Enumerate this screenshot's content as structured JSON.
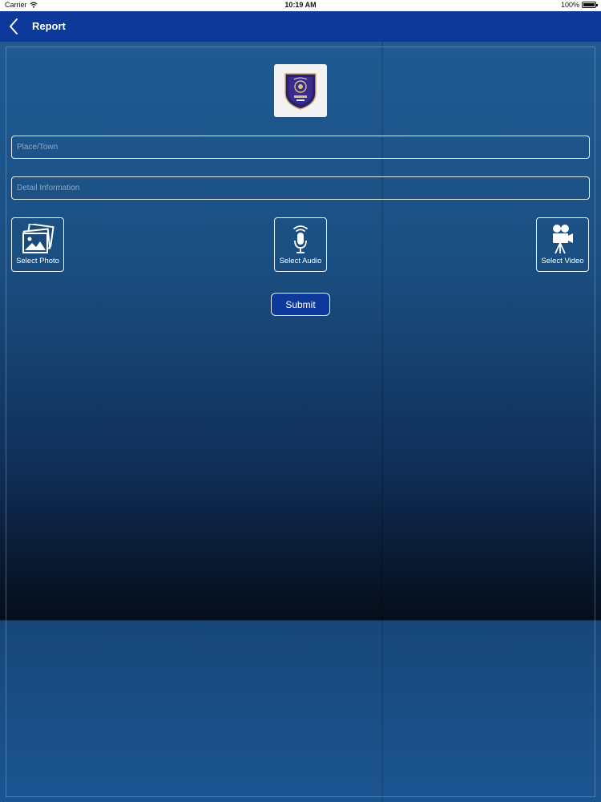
{
  "status_bar": {
    "carrier": "Carrier",
    "time": "10:19 AM",
    "battery": "100%",
    "battery_level": 1.0
  },
  "nav_bar": {
    "title": "Report",
    "back_icon": "chevron-left-icon"
  },
  "logo": {
    "icon": "police-emblem-icon"
  },
  "form": {
    "place_placeholder": "Place/Town",
    "place_value": "",
    "detail_placeholder": "Detail Information",
    "detail_value": ""
  },
  "media": {
    "photo_label": "Select Photo",
    "audio_label": "Select Audio",
    "video_label": "Select Video"
  },
  "submit_label": "Submit",
  "colors": {
    "nav_bar": "#0d3a9a",
    "background_top": "#1f5b93",
    "background_dark": "#050d1a",
    "border": "#e6eef8"
  }
}
